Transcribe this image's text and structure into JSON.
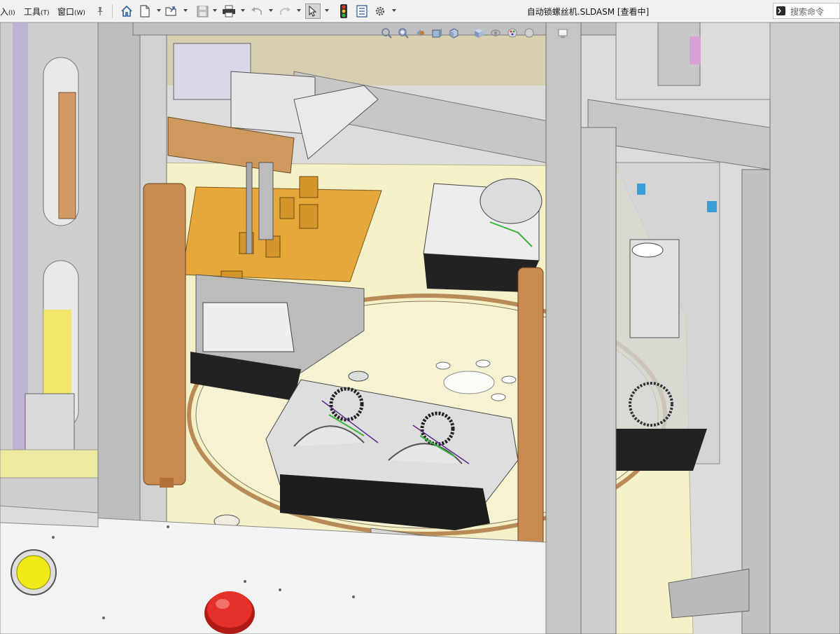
{
  "menu": {
    "insert": {
      "label": "入",
      "accel": "(I)"
    },
    "tools": {
      "label": "工具",
      "accel": "(T)"
    },
    "window": {
      "label": "窗口",
      "accel": "(W)"
    }
  },
  "toolbar": {
    "icons": [
      "pin-icon",
      "home-icon",
      "new-document-icon",
      "open-icon",
      "save-icon",
      "print-icon",
      "undo-icon",
      "redo-icon",
      "select-pointer-icon",
      "rebuild-traffic-light-icon",
      "file-properties-icon",
      "options-gear-icon"
    ]
  },
  "document": {
    "title": "自动锁螺丝机.SLDASM [查看中]"
  },
  "search": {
    "placeholder": "搜索命令",
    "icon": "command-prompt-icon"
  },
  "view_hud": {
    "icons": [
      "zoom-to-fit-icon",
      "zoom-area-icon",
      "previous-view-icon",
      "section-view-icon",
      "view-orientation-icon",
      "display-style-icon",
      "hide-show-icon",
      "edit-appearance-icon",
      "apply-scene-icon",
      "view-settings-icon"
    ]
  },
  "colors": {
    "accent_orange": "#c8862e",
    "wood_brown": "#c98a4f",
    "stop_button_red": "#e5302a",
    "start_button_yellow": "#f2ea18",
    "base_cream": "#f4f0c8",
    "frame_gray": "#c9c9c9"
  }
}
